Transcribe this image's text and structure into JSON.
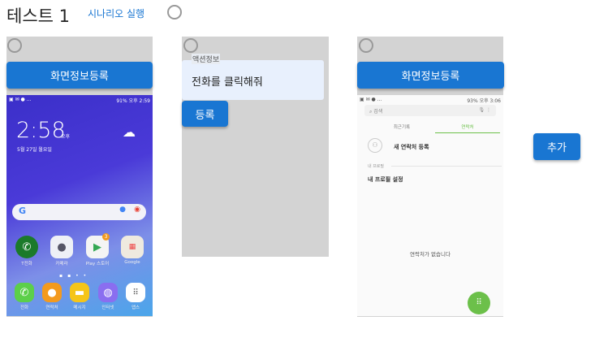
{
  "header": {
    "title": "테스트 1",
    "run_label": "시나리오 실행"
  },
  "panel1": {
    "button": "화면정보등록",
    "phone": {
      "status_right": "91% 오후 2:59",
      "clock": "2:58",
      "ampm": "오후",
      "date": "5월 27일 월요일",
      "apps": [
        {
          "label": "T전화",
          "color": "#1b7a2a"
        },
        {
          "label": "카메라",
          "color": "#eef0f6"
        },
        {
          "label": "Play 스토어",
          "color": "#f4f4f4",
          "badge": "3"
        },
        {
          "label": "Google",
          "color": "#efeadf"
        }
      ],
      "dock": [
        {
          "label": "전화",
          "color": "#5ccf4a"
        },
        {
          "label": "연락처",
          "color": "#f39a1e"
        },
        {
          "label": "메시지",
          "color": "#f5c518"
        },
        {
          "label": "인터넷",
          "color": "#8a6ef0"
        },
        {
          "label": "앱스",
          "color": "#ffffff"
        }
      ]
    }
  },
  "panel2": {
    "field_label": "액션정보",
    "field_value": "전화를 클릭해줘",
    "button": "등록"
  },
  "panel3": {
    "button": "화면정보등록",
    "phone": {
      "status_right": "93% 오후 3:06",
      "search_placeholder": "검색",
      "tabs": [
        "최근기록",
        "연락처"
      ],
      "new_contact": "새 연락처 등록",
      "section": "내 프로필",
      "profile": "내 프로필 설정",
      "empty": "연락처가 없습니다"
    }
  },
  "add_button": "추가",
  "colors": {
    "primary": "#1976d2",
    "green": "#6cc04a"
  }
}
